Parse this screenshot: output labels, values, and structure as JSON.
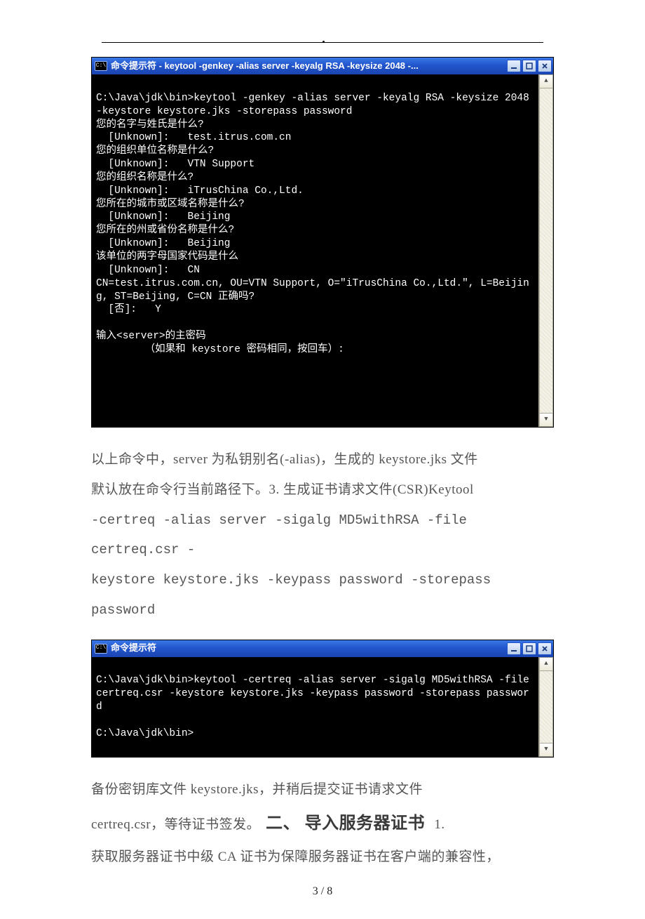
{
  "terminal1": {
    "title": "命令提示符 - keytool -genkey -alias server -keyalg RSA -keysize 2048 -...",
    "icon_label": "C:\\",
    "lines": [
      "",
      "C:\\Java\\jdk\\bin>keytool -genkey -alias server -keyalg RSA -keysize 2048 -keystore keystore.jks -storepass password",
      "您的名字与姓氏是什么?",
      "  [Unknown]:   test.itrus.com.cn",
      "您的组织单位名称是什么?",
      "  [Unknown]:   VTN Support",
      "您的组织名称是什么?",
      "  [Unknown]:   iTrusChina Co.,Ltd.",
      "您所在的城市或区域名称是什么?",
      "  [Unknown]:   Beijing",
      "您所在的州或省份名称是什么?",
      "  [Unknown]:   Beijing",
      "该单位的两字母国家代码是什么",
      "  [Unknown]:   CN",
      "CN=test.itrus.com.cn, OU=VTN Support, O=\"iTrusChina Co.,Ltd.\", L=Beijing, ST=Beijing, C=CN 正确吗?",
      "  [否]:   Y",
      "",
      "输入<server>的主密码",
      "        （如果和 keystore 密码相同，按回车）:"
    ]
  },
  "para1": {
    "l1": "以上命令中，server 为私钥别名(-alias)，生成的 keystore.jks 文件",
    "l2": "默认放在命令行当前路径下。3.    生成证书请求文件(CSR)Keytool",
    "l3": "-certreq -alias server -sigalg MD5withRSA -file certreq.csr -",
    "l4": "keystore keystore.jks -keypass password -storepass password"
  },
  "terminal2": {
    "title": "命令提示符",
    "icon_label": "C:\\",
    "lines": [
      "",
      "C:\\Java\\jdk\\bin>keytool -certreq -alias server -sigalg MD5withRSA -file certreq.csr -keystore keystore.jks -keypass password -storepass password",
      "",
      "C:\\Java\\jdk\\bin>"
    ]
  },
  "para2": {
    "l1": "备份密钥库文件 keystore.jks，并稍后提交证书请求文件",
    "l2a": "certreq.csr，等待证书签发。",
    "heading": "二、    导入服务器证书",
    "l2b": " 1.",
    "l3": " 获取服务器证书中级 CA 证书为保障服务器证书在客户端的兼容性，"
  },
  "pagenum": "3 / 8"
}
